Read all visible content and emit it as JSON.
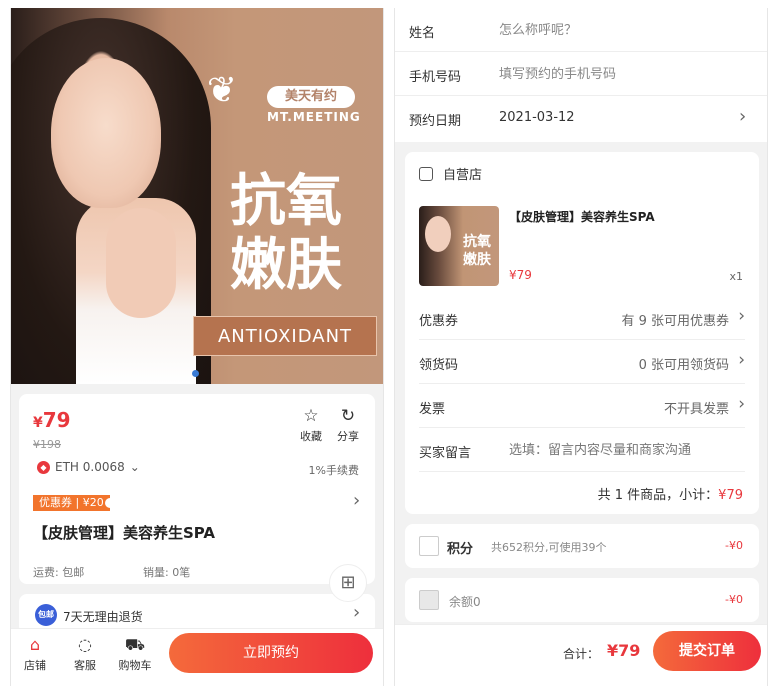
{
  "product_page": {
    "banner": {
      "logo_brand": "美天有约",
      "logo_sub": "MT.MEETING",
      "headline_line1": "抗氧",
      "headline_line2": "嫩肤",
      "tagline": "ANTIOXIDANT"
    },
    "price": "¥79",
    "price_symbol": "¥",
    "price_amount": "79",
    "old_price": "¥198",
    "eth_label": "ETH 0.0068",
    "fee_label": "1%手续费",
    "favorite_label": "收藏",
    "share_label": "分享",
    "coupon_label": "优惠券 | ¥20",
    "product_title": "【皮肤管理】美容养生SPA",
    "shipping_label": "运费: 包邮",
    "sales_label": "销量: 0笔",
    "return_badge": "包邮",
    "return_text": "7天无理由退货",
    "bottom_bar": {
      "shop_label": "店铺",
      "service_label": "客服",
      "cart_label": "购物车",
      "reserve_button": "立即预约"
    }
  },
  "order_page": {
    "form": {
      "name_label": "姓名",
      "name_placeholder": "怎么称呼呢？",
      "phone_label": "手机号码",
      "phone_placeholder": "填写预约的手机号码",
      "date_label": "预约日期",
      "date_value": "2021-03-12"
    },
    "shop_name": "自营店",
    "product": {
      "title": "【皮肤管理】美容养生SPA",
      "price": "¥79",
      "qty": "x1",
      "thumb_text_1": "抗氧",
      "thumb_text_2": "嫩肤"
    },
    "rows": {
      "coupon_label": "优惠券",
      "coupon_value": "有 9 张可用优惠券",
      "code_label": "领货码",
      "code_value": "0 张可用领货码",
      "invoice_label": "发票",
      "invoice_value": "不开具发票",
      "message_label": "买家留言",
      "message_placeholder": "选填：留言内容尽量和商家沟通"
    },
    "subtotal_text": "共 1 件商品，小计：",
    "subtotal_value": "¥79",
    "points": {
      "label": "积分",
      "desc": "共652积分,可使用39个",
      "value": "-¥0"
    },
    "balance": {
      "label": "余额0",
      "value": "-¥0"
    },
    "total_label": "合计：",
    "total_value": "¥79",
    "submit_button": "提交订单"
  },
  "colors": {
    "accent_red": "#e8383d",
    "button_gradient_start": "#f46a3b",
    "button_gradient_end": "#ee2f3c",
    "coupon_orange": "#f2742c",
    "background_gray": "#f2f2f2"
  },
  "icons": [
    "star-icon",
    "share-icon",
    "eth-icon",
    "chevron-down-icon",
    "chevron-right-icon",
    "grid-icon",
    "shop-icon",
    "chat-icon",
    "cart-icon",
    "store-icon",
    "checkbox-icon"
  ]
}
